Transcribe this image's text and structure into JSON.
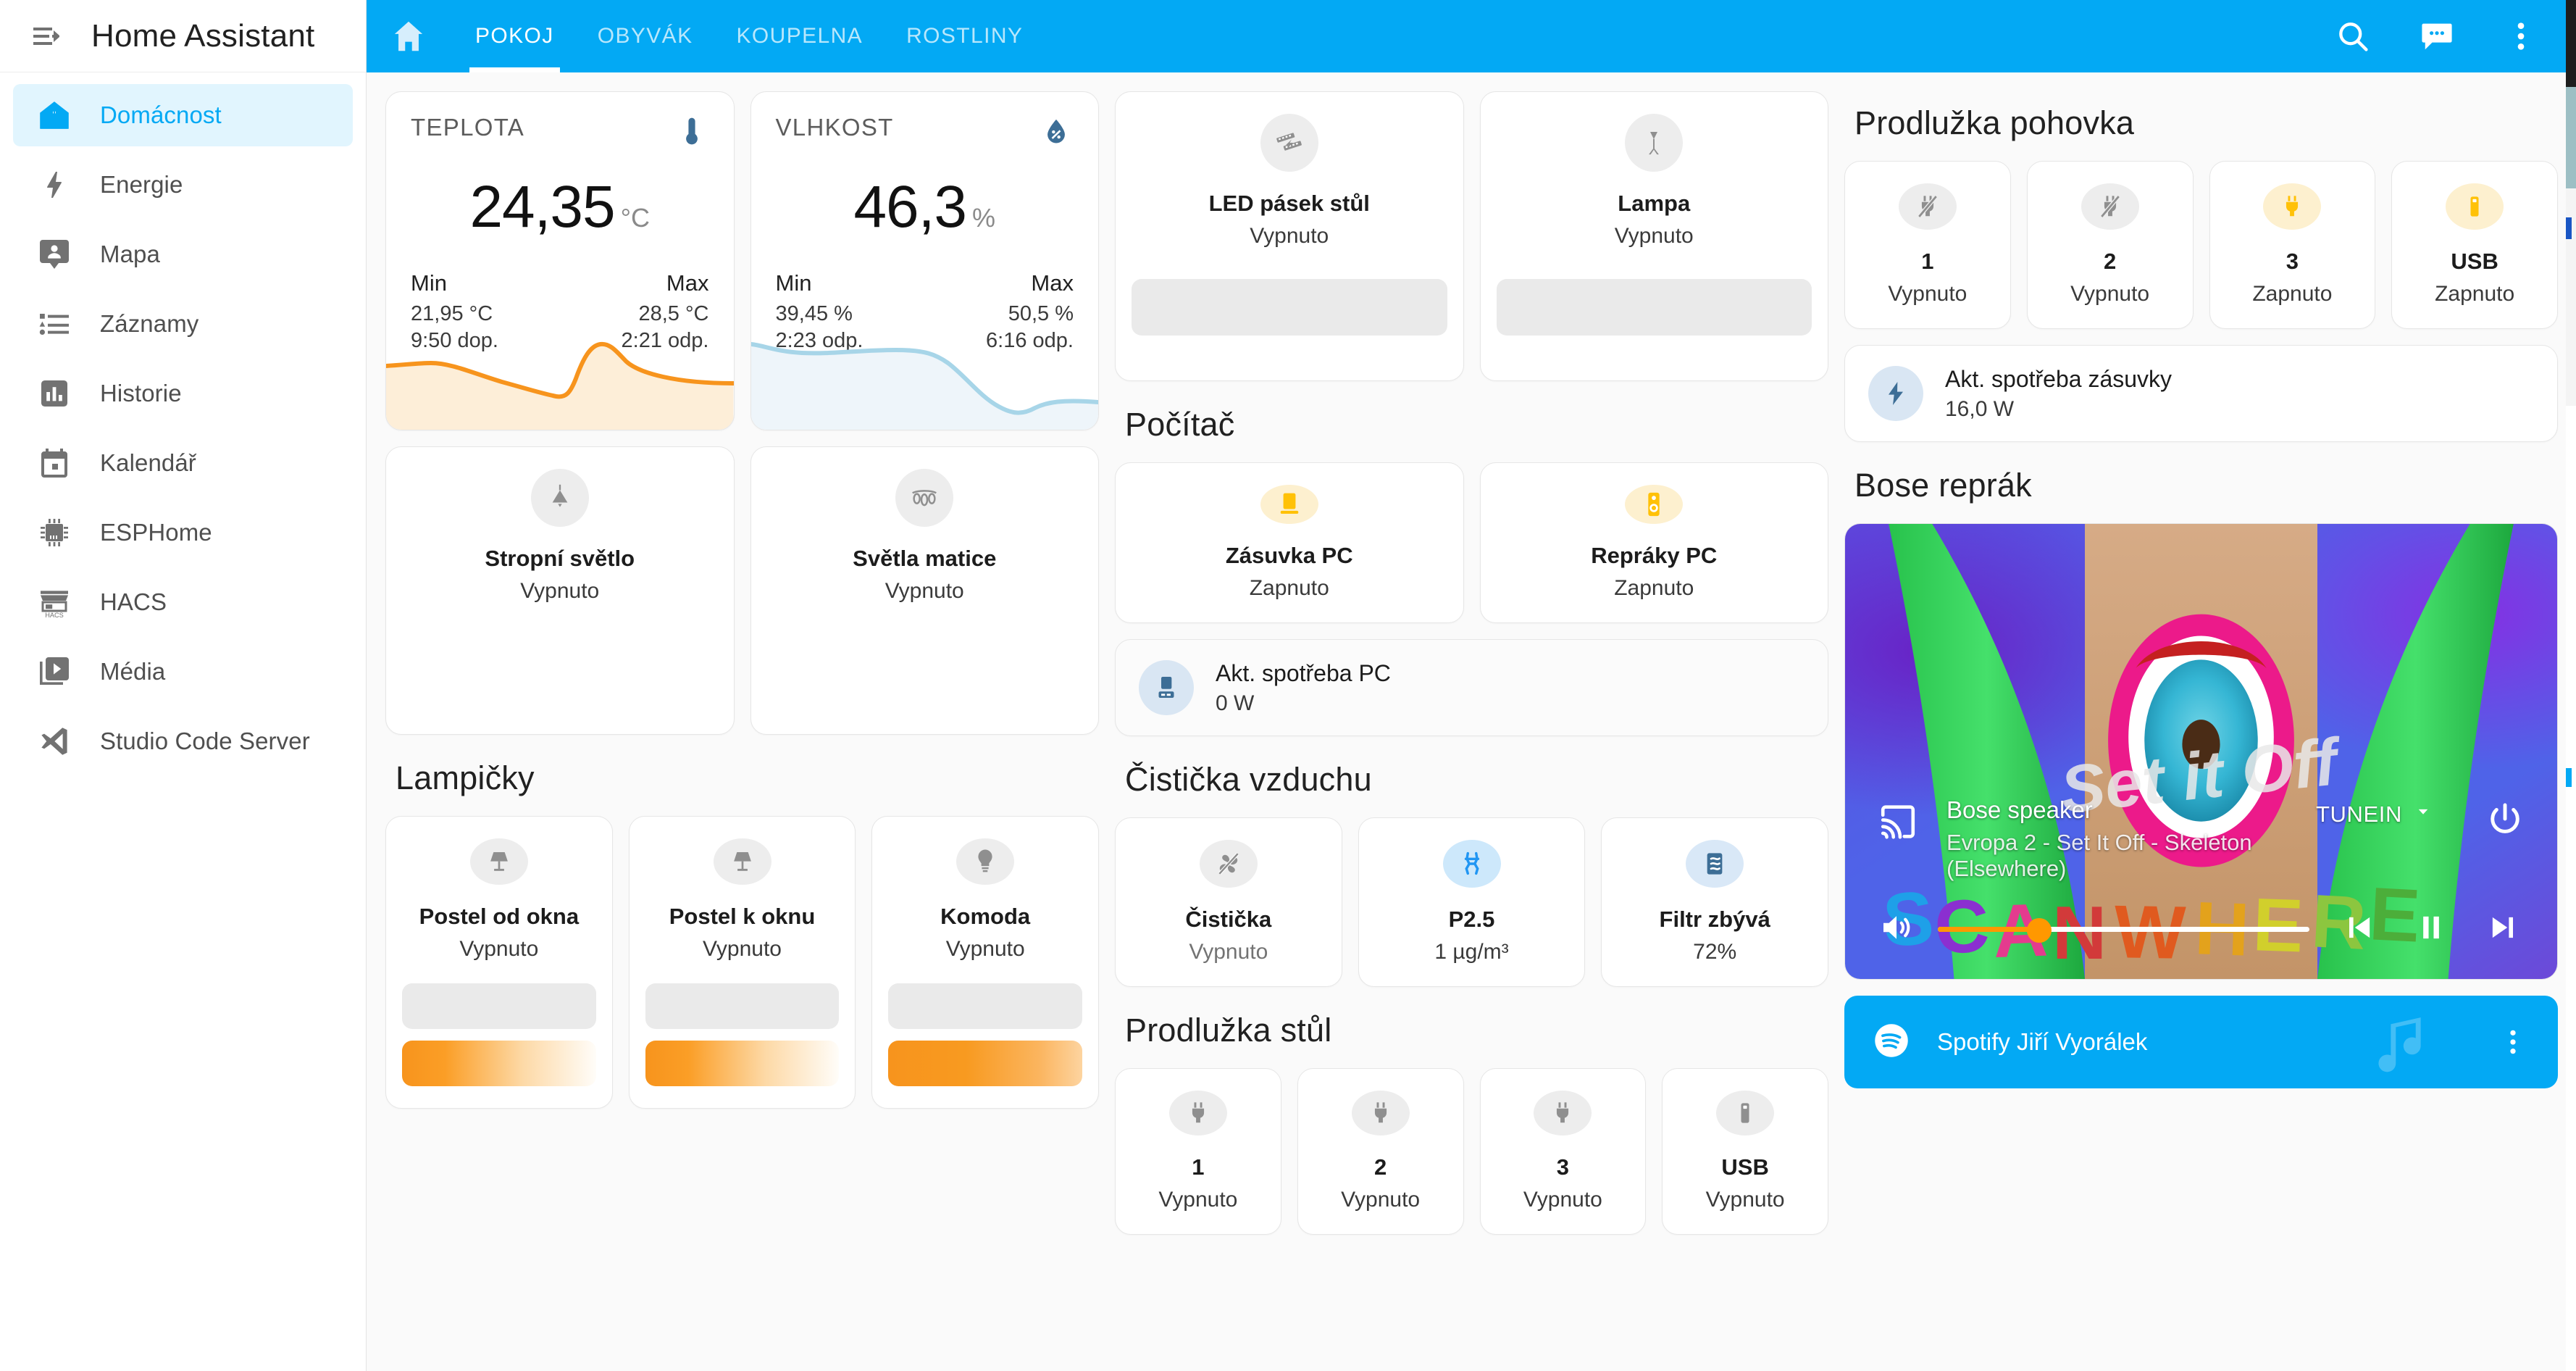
{
  "colors": {
    "accent": "#03a9f4",
    "on_yellow": "#ffc107",
    "off_grey": "#8f8f8f",
    "temp_line": "#f7941d",
    "hum_line": "#a7d5e8",
    "spotify_bar": "#03a9f4"
  },
  "sidebar": {
    "title": "Home Assistant",
    "menu_icon": "menu-collapse-icon",
    "items": [
      {
        "label": "Domácnost",
        "icon": "home-assistant-icon",
        "active": true
      },
      {
        "label": "Energie",
        "icon": "lightning-bolt-icon",
        "active": false
      },
      {
        "label": "Mapa",
        "icon": "map-marker-account-icon",
        "active": false
      },
      {
        "label": "Záznamy",
        "icon": "format-list-bulleted-icon",
        "active": false
      },
      {
        "label": "Historie",
        "icon": "chart-box-icon",
        "active": false
      },
      {
        "label": "Kalendář",
        "icon": "calendar-icon",
        "active": false
      },
      {
        "label": "ESPHome",
        "icon": "chip-icon",
        "active": false
      },
      {
        "label": "HACS",
        "icon": "storefront-icon",
        "active": false
      },
      {
        "label": "Média",
        "icon": "play-box-multiple-icon",
        "active": false
      },
      {
        "label": "Studio Code Server",
        "icon": "vscode-icon",
        "active": false
      }
    ]
  },
  "topbar": {
    "home_icon": "home-icon",
    "tabs": [
      {
        "label": "POKOJ",
        "selected": true
      },
      {
        "label": "OBYVÁK",
        "selected": false
      },
      {
        "label": "KOUPELNA",
        "selected": false
      },
      {
        "label": "ROSTLINY",
        "selected": false
      }
    ],
    "actions": [
      {
        "icon": "search-icon",
        "name": "search-button"
      },
      {
        "icon": "assist-chat-icon",
        "name": "assist-button"
      },
      {
        "icon": "overflow-menu-icon",
        "name": "overflow-menu-button"
      }
    ]
  },
  "col_a": {
    "sensors": [
      {
        "name": "TEPLOTA",
        "icon": "thermometer-icon",
        "value": "24,35",
        "unit": "°C",
        "min_label": "Min",
        "min_value": "21,95 °C",
        "min_time": "9:50 dop.",
        "max_label": "Max",
        "max_value": "28,5 °C",
        "max_time": "2:21 odp."
      },
      {
        "name": "VLHKOST",
        "icon": "water-percent-icon",
        "value": "46,3",
        "unit": "%",
        "min_label": "Min",
        "min_value": "39,45 %",
        "min_time": "2:23 odp.",
        "max_label": "Max",
        "max_value": "50,5 %",
        "max_time": "6:16 odp."
      }
    ],
    "lights": [
      {
        "name": "Stropní světlo",
        "state": "Vypnuto",
        "icon": "ceiling-light-icon",
        "on": false
      },
      {
        "name": "Světla matice",
        "state": "Vypnuto",
        "icon": "light-matrix-icon",
        "on": false
      }
    ],
    "lampicky_title": "Lampičky",
    "lampicky": [
      {
        "name": "Postel od okna",
        "state": "Vypnuto",
        "icon": "lamp-icon",
        "on": false
      },
      {
        "name": "Postel k oknu",
        "state": "Vypnuto",
        "icon": "lamp-icon",
        "on": false
      },
      {
        "name": "Komoda",
        "state": "Vypnuto",
        "icon": "bulb-icon",
        "on": false
      }
    ]
  },
  "col_b": {
    "top_lights": [
      {
        "name": "LED pásek stůl",
        "state": "Vypnuto",
        "icon": "led-strip-icon",
        "on": false
      },
      {
        "name": "Lampa",
        "state": "Vypnuto",
        "icon": "floor-lamp-icon",
        "on": false
      }
    ],
    "pocitac_title": "Počítač",
    "pocitac": [
      {
        "name": "Zásuvka PC",
        "state": "Zapnuto",
        "icon": "monitor-icon",
        "on": true
      },
      {
        "name": "Repráky PC",
        "state": "Zapnuto",
        "icon": "speaker-icon",
        "on": true
      }
    ],
    "pocitac_power": {
      "name": "Akt. spotřeba PC",
      "state": "0 W",
      "icon": "laptop-power-icon"
    },
    "cisticka_title": "Čistička vzduchu",
    "cisticka": [
      {
        "name": "Čistička",
        "state": "Vypnuto",
        "icon": "fan-off-icon",
        "on": false
      },
      {
        "name": "P2.5",
        "state": "1 µg/m³",
        "icon": "molecule-icon",
        "on": true
      },
      {
        "name": "Filtr zbývá",
        "state": "72%",
        "icon": "air-filter-icon",
        "on": false
      }
    ],
    "prodluzka_stul_title": "Prodlužka stůl",
    "prodluzka_stul": [
      {
        "name": "1",
        "state": "Vypnuto",
        "icon": "power-plug-icon",
        "on": false
      },
      {
        "name": "2",
        "state": "Vypnuto",
        "icon": "power-plug-icon",
        "on": false
      },
      {
        "name": "3",
        "state": "Vypnuto",
        "icon": "power-plug-icon",
        "on": false
      },
      {
        "name": "USB",
        "state": "Vypnuto",
        "icon": "usb-icon",
        "on": false
      }
    ]
  },
  "col_c": {
    "prodluzka_pohovka_title": "Prodlužka pohovka",
    "prodluzka_pohovka": [
      {
        "name": "1",
        "state": "Vypnuto",
        "icon": "power-plug-off-icon",
        "on": false
      },
      {
        "name": "2",
        "state": "Vypnuto",
        "icon": "power-plug-off-icon",
        "on": false
      },
      {
        "name": "3",
        "state": "Zapnuto",
        "icon": "power-plug-icon",
        "on": true
      },
      {
        "name": "USB",
        "state": "Zapnuto",
        "icon": "usb-icon",
        "on": true
      }
    ],
    "pohovka_power": {
      "name": "Akt. spotřeba zásuvky",
      "state": "16,0 W",
      "icon": "lightning-bolt-icon"
    },
    "bose_title": "Bose reprák",
    "media": {
      "device": "Bose speaker",
      "now_playing": "Evropa 2 - Set It Off - Skeleton (Elsewhere)",
      "source": "TUNEIN",
      "source_chevron": "chevron-down-icon",
      "cast_icon": "cast-icon",
      "power_icon": "power-icon",
      "volume_icon": "volume-high-icon",
      "volume_percent": 27,
      "prev_icon": "skip-previous-icon",
      "play_pause_icon": "pause-icon",
      "next_icon": "skip-next-icon"
    },
    "spotify": {
      "label": "Spotify Jiří Vyorálek",
      "logo_icon": "spotify-icon",
      "more_icon": "overflow-menu-icon",
      "note_icon": "music-note-icon"
    }
  }
}
